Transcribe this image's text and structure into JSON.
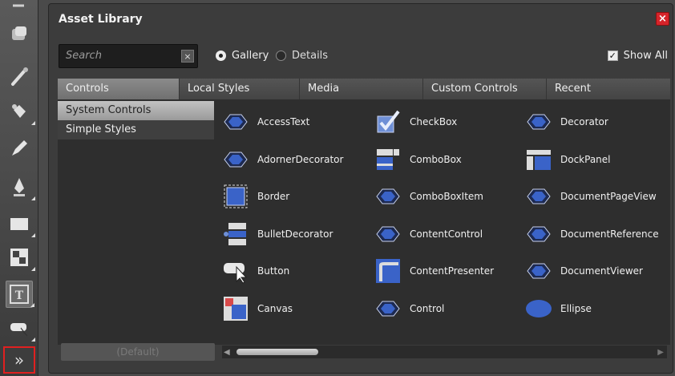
{
  "panel": {
    "title": "Asset Library",
    "close_label": "×"
  },
  "search": {
    "placeholder": "Search",
    "clear_label": "×"
  },
  "view_mode": {
    "gallery_label": "Gallery",
    "details_label": "Details",
    "selected": "Gallery"
  },
  "show_all": {
    "label": "Show All",
    "checked": true,
    "check_glyph": "✓"
  },
  "tabs": [
    {
      "label": "Controls",
      "active": true
    },
    {
      "label": "Local Styles",
      "active": false
    },
    {
      "label": "Media",
      "active": false
    },
    {
      "label": "Custom Controls",
      "active": false
    },
    {
      "label": "Recent",
      "active": false
    }
  ],
  "categories": [
    {
      "label": "System Controls",
      "selected": true
    },
    {
      "label": "Simple Styles",
      "selected": false
    }
  ],
  "controls": [
    {
      "label": "AccessText",
      "icon": "diamond-control-icon"
    },
    {
      "label": "CheckBox",
      "icon": "checkbox-icon"
    },
    {
      "label": "Decorator",
      "icon": "diamond-control-icon"
    },
    {
      "label": "AdornerDecorator",
      "icon": "diamond-control-icon"
    },
    {
      "label": "ComboBox",
      "icon": "combobox-icon"
    },
    {
      "label": "DockPanel",
      "icon": "dockpanel-icon"
    },
    {
      "label": "Border",
      "icon": "border-icon"
    },
    {
      "label": "ComboBoxItem",
      "icon": "diamond-control-icon"
    },
    {
      "label": "DocumentPageView",
      "icon": "diamond-control-icon"
    },
    {
      "label": "BulletDecorator",
      "icon": "bulletdecorator-icon"
    },
    {
      "label": "ContentControl",
      "icon": "diamond-control-icon"
    },
    {
      "label": "DocumentReference",
      "icon": "diamond-control-icon"
    },
    {
      "label": "Button",
      "icon": "button-icon"
    },
    {
      "label": "ContentPresenter",
      "icon": "contentpresenter-icon"
    },
    {
      "label": "DocumentViewer",
      "icon": "diamond-control-icon"
    },
    {
      "label": "Canvas",
      "icon": "canvas-icon"
    },
    {
      "label": "Control",
      "icon": "diamond-control-icon"
    },
    {
      "label": "Ellipse",
      "icon": "ellipse-icon"
    }
  ],
  "bottom": {
    "default_label": "(Default)",
    "scroll_left": "◀",
    "scroll_right": "▶"
  },
  "toolbox": {
    "expand_label": "»",
    "tools": [
      "pan-icon",
      "zoom-icon",
      "eyedropper-icon",
      "paint-bucket-icon",
      "brush-icon",
      "pen-icon",
      "rectangle-icon",
      "grid-icon",
      "text-icon",
      "button-tool-icon"
    ]
  },
  "colors": {
    "accent_blue": "#3a63c8",
    "close_red": "#d6242a",
    "expand_border": "#e02020"
  }
}
